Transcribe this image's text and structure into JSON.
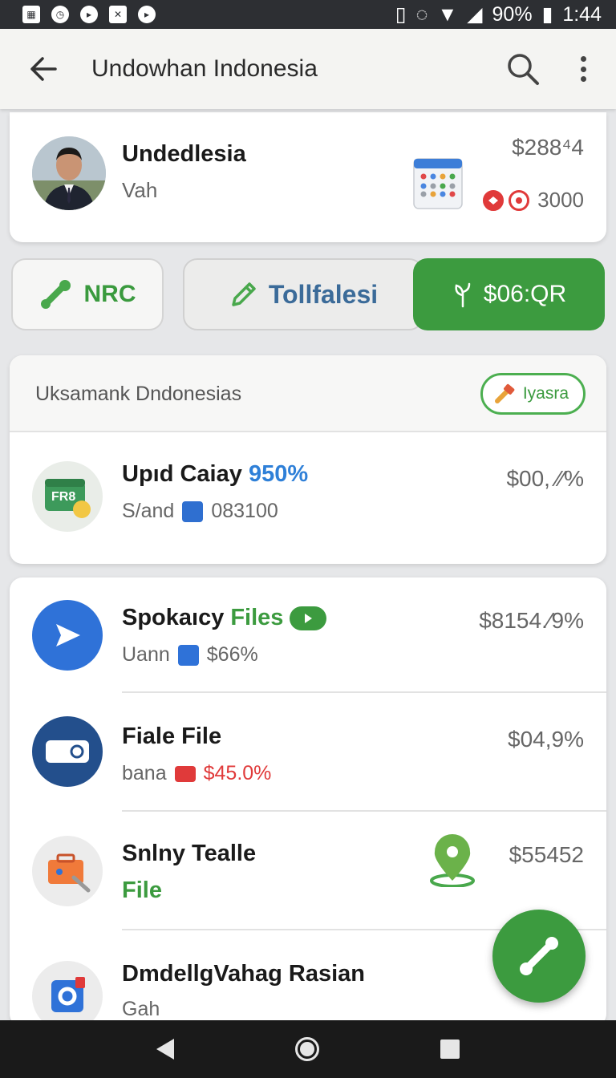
{
  "status_bar": {
    "battery": "90%",
    "time": "1:44"
  },
  "app_bar": {
    "title": "Undowhan Indonesia"
  },
  "profile": {
    "name": "Undedlesia",
    "subtitle": "Vah",
    "amount": "$288⁴4",
    "badge_value": "3000"
  },
  "actions": [
    {
      "label": "NRC"
    },
    {
      "label": "Tollfalesi"
    },
    {
      "label": "$06:QR"
    }
  ],
  "section": {
    "label": "Uksamank Dndonesias",
    "chip": "Iyasra",
    "item": {
      "icon_text": "FR8",
      "title": "Upıd Caiay",
      "title_accent": "950%",
      "sub": "S/and",
      "sub_value": "083100",
      "amount": "$00, ⁄⁄%"
    }
  },
  "list": [
    {
      "title": "Spokaıcy",
      "title_accent": "Files",
      "sub": "Uann",
      "sub_value": "$66%",
      "amount": "$8154.⁄9%"
    },
    {
      "title": "Fiale File",
      "sub": "bana",
      "sub_value": "$45.0%",
      "amount": "$04,9%"
    },
    {
      "title": "Snlny Tealle",
      "title2": "File",
      "amount": "$55452"
    },
    {
      "title": "DmdellgVahag Rasian",
      "sub": "Gah"
    }
  ],
  "colors": {
    "accent_green": "#3c9b3f",
    "accent_blue": "#2f80d8",
    "accent_red": "#e03a3a"
  }
}
